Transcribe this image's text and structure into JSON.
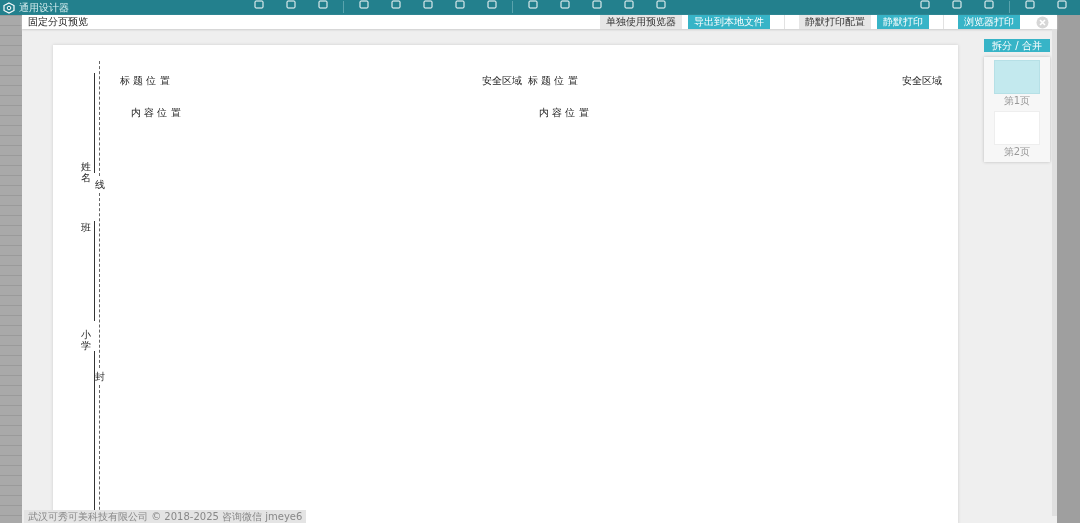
{
  "app": {
    "title": "通用设计器"
  },
  "preview": {
    "title": "固定分页预览",
    "buttons": [
      {
        "label": "单独使用预览器",
        "kind": "plain"
      },
      {
        "label": "导出到本地文件",
        "kind": "primary"
      },
      {
        "label": "静默打印配置",
        "kind": "plain"
      },
      {
        "label": "静默打印",
        "kind": "primary"
      },
      {
        "label": "浏览器打印",
        "kind": "primary"
      }
    ]
  },
  "paper": {
    "binding": {
      "fields": [
        "姓名",
        "班",
        "小学"
      ],
      "seal_marks": [
        "线",
        "封"
      ]
    },
    "columns": [
      {
        "title": "标 题 位 置",
        "safe_area": "安全区域",
        "content": "内 容 位 置"
      },
      {
        "title": "标 题 位 置",
        "safe_area": "安全区域",
        "content": "内 容 位 置"
      }
    ]
  },
  "thumbnails": {
    "toggle": "拆分 / 合并",
    "pages": [
      {
        "label": "第1页",
        "selected": true
      },
      {
        "label": "第2页",
        "selected": false
      }
    ]
  },
  "footer": "武汉可秀可美科技有限公司 © 2018-2025  咨询微信 jmeye6"
}
